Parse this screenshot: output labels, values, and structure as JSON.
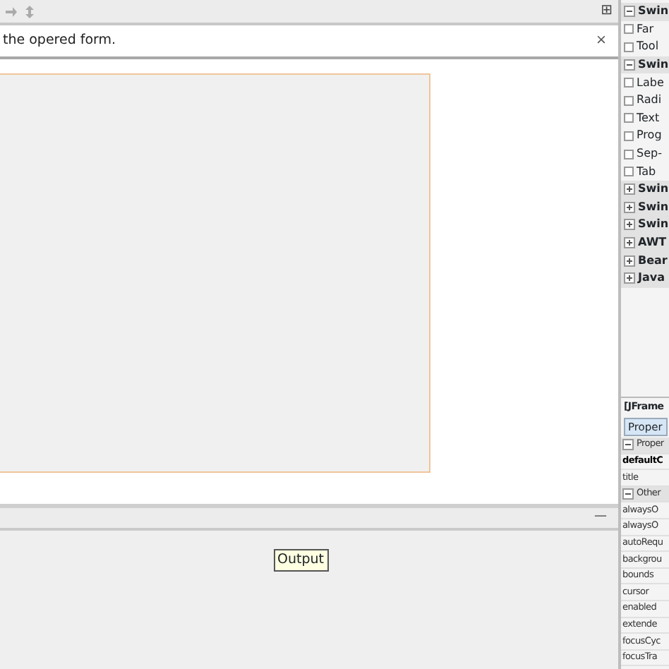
{
  "toolbar": {
    "expand_symbol": "⊞"
  },
  "message_bar": {
    "text": "the opered form.",
    "close": "×"
  },
  "output_panel": {
    "minimize": "—",
    "tooltip": "Output"
  },
  "palette": [
    {
      "kind": "category",
      "label": "Swin",
      "expanded": true
    },
    {
      "kind": "item",
      "label": "Far"
    },
    {
      "kind": "item",
      "label": "Tool"
    },
    {
      "kind": "category",
      "label": "Swin",
      "expanded": true
    },
    {
      "kind": "item",
      "label": "Labe"
    },
    {
      "kind": "item",
      "label": "Radi"
    },
    {
      "kind": "item",
      "label": "Text"
    },
    {
      "kind": "item",
      "label": "Prog"
    },
    {
      "kind": "item",
      "label": "Sep-"
    },
    {
      "kind": "item",
      "label": "Tab"
    },
    {
      "kind": "category",
      "label": "Swin",
      "expanded": false
    },
    {
      "kind": "category",
      "label": "Swin",
      "expanded": false
    },
    {
      "kind": "category",
      "label": "Swin",
      "expanded": false
    },
    {
      "kind": "category",
      "label": "AWT",
      "expanded": false
    },
    {
      "kind": "category",
      "label": "Bear",
      "expanded": false
    },
    {
      "kind": "category",
      "label": "Java",
      "expanded": false
    }
  ],
  "properties": {
    "title": "[JFrame",
    "tabs": [
      {
        "label": "Proper",
        "selected": true
      }
    ],
    "rows": [
      {
        "kind": "category",
        "label": "Proper",
        "expanded": true
      },
      {
        "kind": "property",
        "label": "defaultC",
        "modified": true
      },
      {
        "kind": "property",
        "label": "title",
        "modified": false
      },
      {
        "kind": "category",
        "label": "Other",
        "expanded": true
      },
      {
        "kind": "property",
        "label": "alwaysO",
        "modified": false
      },
      {
        "kind": "property",
        "label": "alwaysO",
        "modified": false
      },
      {
        "kind": "property",
        "label": "autoRequ",
        "modified": false
      },
      {
        "kind": "property",
        "label": "backgrou",
        "modified": false
      },
      {
        "kind": "property",
        "label": "bounds",
        "modified": false
      },
      {
        "kind": "property",
        "label": "cursor",
        "modified": false
      },
      {
        "kind": "property",
        "label": "enabled",
        "modified": false
      },
      {
        "kind": "property",
        "label": "extende",
        "modified": false
      },
      {
        "kind": "property",
        "label": "focusCyc",
        "modified": false
      },
      {
        "kind": "property",
        "label": "focusTra",
        "modified": false
      }
    ]
  }
}
